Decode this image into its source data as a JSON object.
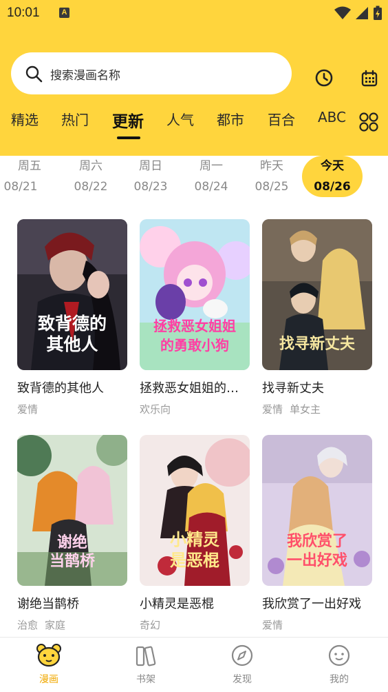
{
  "status_bar": {
    "time": "10:01",
    "notification_badge": "A"
  },
  "search": {
    "placeholder": "搜索漫画名称"
  },
  "tabs": [
    {
      "label": "精选"
    },
    {
      "label": "热门"
    },
    {
      "label": "更新"
    },
    {
      "label": "人气"
    },
    {
      "label": "都市"
    },
    {
      "label": "百合"
    },
    {
      "label": "ABC"
    }
  ],
  "active_tab": "更新",
  "dates": [
    {
      "day": "周五",
      "date": "08/21"
    },
    {
      "day": "周六",
      "date": "08/22"
    },
    {
      "day": "周日",
      "date": "08/23"
    },
    {
      "day": "周一",
      "date": "08/24"
    },
    {
      "day": "昨天",
      "date": "08/25"
    },
    {
      "day": "今天",
      "date": "08/26"
    }
  ],
  "comics": [
    {
      "title": "致背德的其他人",
      "cover_text": "致背德的\n其他人",
      "tags": [
        "爱情"
      ]
    },
    {
      "title": "拯救恶女姐姐的勇敢小狗",
      "cover_text": "拯救恶女姐姐\n的勇敢小狗",
      "tags": [
        "欢乐向"
      ]
    },
    {
      "title": "找寻新丈夫",
      "cover_text": "找寻新丈夫",
      "tags": [
        "爱情",
        "单女主"
      ]
    },
    {
      "title": "谢绝当鹊桥",
      "cover_text": "谢绝\n当鹊桥",
      "tags": [
        "治愈",
        "家庭"
      ]
    },
    {
      "title": "小精灵是恶棍",
      "cover_text": "小精灵\n是恶棍",
      "tags": [
        "奇幻"
      ]
    },
    {
      "title": "我欣赏了一出好戏",
      "cover_text": "我欣赏了\n一出好戏",
      "tags": [
        "爱情"
      ]
    }
  ],
  "bottom_nav": [
    {
      "label": "漫画",
      "icon": "bear-icon"
    },
    {
      "label": "书架",
      "icon": "bookshelf-icon"
    },
    {
      "label": "发现",
      "icon": "compass-icon"
    },
    {
      "label": "我的",
      "icon": "face-icon"
    }
  ],
  "colors": {
    "brand_yellow": "#FFD53D",
    "active_nav": "#F0A800"
  }
}
